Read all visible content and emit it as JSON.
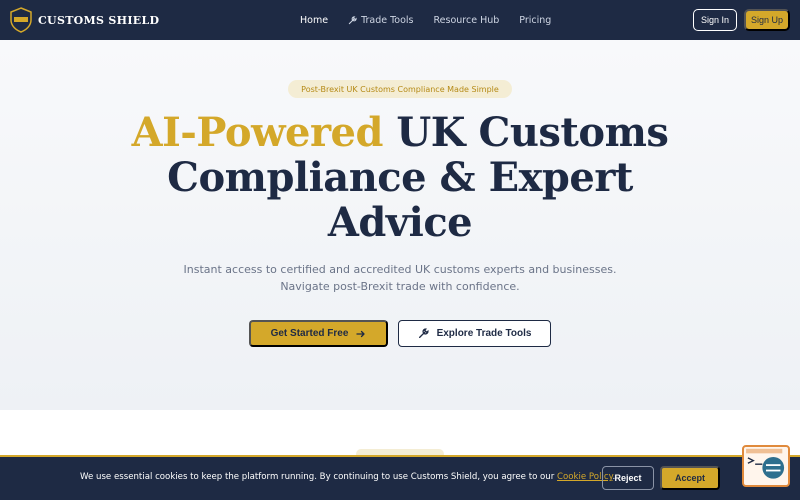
{
  "brand": {
    "name": "CUSTOMS SHIELD"
  },
  "nav": {
    "items": [
      {
        "label": "Home",
        "active": true
      },
      {
        "label": "Trade Tools",
        "icon": "wrench-icon"
      },
      {
        "label": "Resource Hub"
      },
      {
        "label": "Pricing"
      }
    ],
    "sign_in": "Sign In",
    "sign_up": "Sign Up"
  },
  "hero": {
    "badge": "Post-Brexit UK Customs Compliance Made Simple",
    "headline_accent": "AI-Powered",
    "headline_rest": "UK Customs Compliance & Expert Advice",
    "subtext_line1": "Instant access to certified and accredited UK customs experts and businesses.",
    "subtext_line2": "Navigate post-Brexit trade with confidence.",
    "primary_cta": "Get Started Free",
    "secondary_cta": "Explore Trade Tools"
  },
  "cookie": {
    "text": "We use essential cookies to keep the platform running. By continuing to use Customs Shield, you agree to our",
    "link": "Cookie Policy",
    "period": ".",
    "reject": "Reject",
    "accept": "Accept"
  },
  "colors": {
    "navy": "#1e2a44",
    "gold": "#d4a82a",
    "badge_bg": "#f4edd4"
  }
}
